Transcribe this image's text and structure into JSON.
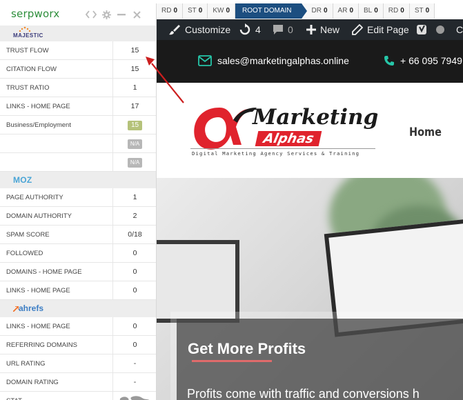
{
  "metrics_bar": [
    {
      "label": "RD",
      "value": "0",
      "active": false
    },
    {
      "label": "ST",
      "value": "0",
      "active": false
    },
    {
      "label": "KW",
      "value": "0",
      "active": false
    },
    {
      "label": "ROOT DOMAIN",
      "value": "",
      "active": true
    },
    {
      "label": "DR",
      "value": "0",
      "active": false
    },
    {
      "label": "AR",
      "value": "0",
      "active": false
    },
    {
      "label": "BL",
      "value": "0",
      "active": false
    },
    {
      "label": "RD",
      "value": "0",
      "active": false
    },
    {
      "label": "ST",
      "value": "0",
      "active": false
    }
  ],
  "panel": {
    "brand": "serpworx",
    "majestic": {
      "logo_text": "MAJESTIC",
      "rows": [
        {
          "label": "TRUST FLOW",
          "value": "15"
        },
        {
          "label": "CITATION FLOW",
          "value": "15"
        },
        {
          "label": "TRUST RATIO",
          "value": "1"
        },
        {
          "label": "LINKS - HOME PAGE",
          "value": "17"
        },
        {
          "label": "Business/Employment",
          "badge": "15"
        },
        {
          "label": "",
          "badge_na": "N/A"
        },
        {
          "label": "",
          "badge_na": "N/A"
        }
      ]
    },
    "moz": {
      "logo_text": "MOZ",
      "rows": [
        {
          "label": "PAGE AUTHORITY",
          "value": "1"
        },
        {
          "label": "DOMAIN AUTHORITY",
          "value": "2"
        },
        {
          "label": "SPAM SCORE",
          "value": "0/18"
        },
        {
          "label": "FOLLOWED",
          "value": "0"
        },
        {
          "label": "DOMAINS - HOME PAGE",
          "value": "0"
        },
        {
          "label": "LINKS - HOME PAGE",
          "value": "0"
        }
      ]
    },
    "ahrefs": {
      "logo_text": "ahrefs",
      "rows": [
        {
          "label": "LINKS - HOME PAGE",
          "value": "0"
        },
        {
          "label": "REFERRING DOMAINS",
          "value": "0"
        },
        {
          "label": "URL RATING",
          "value": "-"
        },
        {
          "label": "DOMAIN RATING",
          "value": "-"
        },
        {
          "label": "STAT",
          "value": ""
        }
      ]
    }
  },
  "admin_bar": {
    "customize": "Customize",
    "updates_count": "4",
    "comments_count": "0",
    "new": "New",
    "edit_page": "Edit Page",
    "cut_off": "C"
  },
  "contact": {
    "email": "sales@marketingalphas.online",
    "phone": "+ 66 095 7949"
  },
  "site": {
    "logo_line1": "Marketing",
    "logo_line2": "Alphas",
    "tagline": "Digital Marketing Agency Services & Training",
    "nav_home": "Home",
    "hero_title": "Get More Profits",
    "hero_text": "Profits come with traffic and conversions h"
  },
  "colors": {
    "brand_green": "#2d8e3b",
    "metrics_active": "#1c4e80",
    "arrow": "#cc1f1f",
    "logo_red": "#e0232d"
  }
}
